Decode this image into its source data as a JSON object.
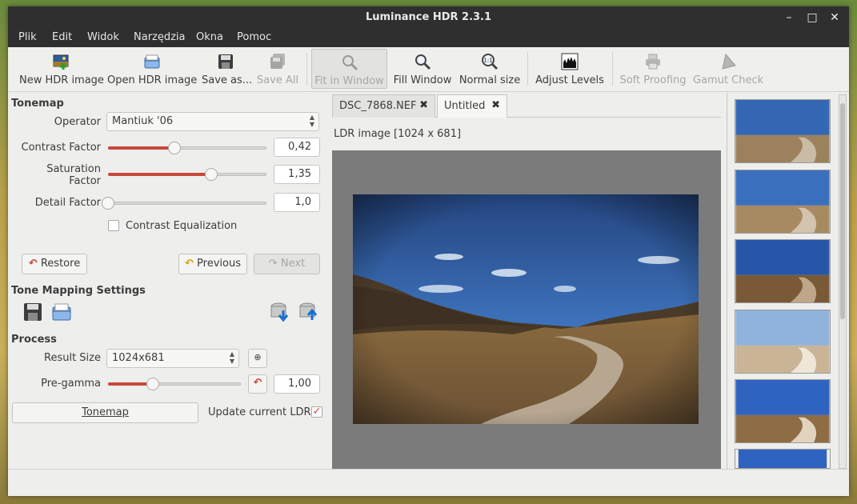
{
  "window": {
    "title": "Luminance HDR 2.3.1"
  },
  "menu": [
    "Plik",
    "Edit",
    "Widok",
    "Narzędzia",
    "Okna",
    "Pomoc"
  ],
  "toolbar": {
    "new_hdr": "New HDR image",
    "open_hdr": "Open HDR image",
    "save_as": "Save as...",
    "save_all": "Save All",
    "fit_in_window": "Fit in Window",
    "fill_window": "Fill Window",
    "normal_size": "Normal size",
    "normal_size_icon_text": "1:1",
    "adjust_levels": "Adjust Levels",
    "soft_proofing": "Soft Proofing",
    "gamut_check": "Gamut Check"
  },
  "tonemap": {
    "section": "Tonemap",
    "operator_label": "Operator",
    "operator_value": "Mantiuk '06",
    "contrast_label": "Contrast Factor",
    "contrast_value": "0,42",
    "contrast_level": 0.42,
    "saturation_label_1": "Saturation",
    "saturation_label_2": "Factor",
    "saturation_value": "1,35",
    "saturation_level": 0.65,
    "detail_label": "Detail Factor",
    "detail_value": "1,0",
    "detail_level": 0.0,
    "contrast_eq_label": "Contrast Equalization",
    "restore": "Restore",
    "previous": "Previous",
    "next": "Next"
  },
  "settings": {
    "section": "Tone Mapping Settings"
  },
  "process": {
    "section": "Process",
    "result_size_label": "Result Size",
    "result_size_value": "1024x681",
    "pregamma_label": "Pre-gamma",
    "pregamma_value": "1,00",
    "pregamma_level": 0.34,
    "tonemap_button": "Tonemap",
    "update_ldr_label": "Update current LDR"
  },
  "tabs": [
    {
      "label": "DSC_7868.NEF",
      "active": false
    },
    {
      "label": "Untitled",
      "active": true
    }
  ],
  "viewer": {
    "caption": "LDR image [1024 x 681]"
  },
  "colors": {
    "accent": "#c8473b",
    "titlebar": "#2f2f2f",
    "sky": "#3a6ab8"
  }
}
